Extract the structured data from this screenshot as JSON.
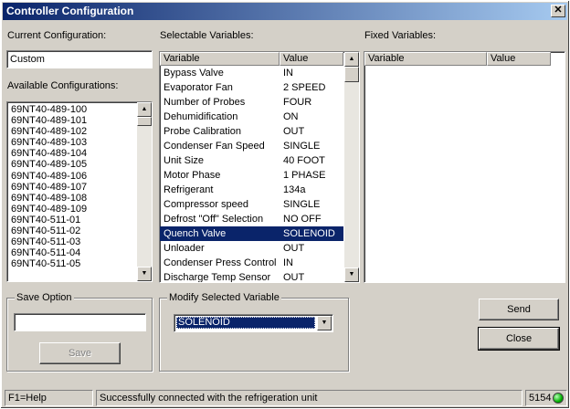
{
  "window": {
    "title": "Controller Configuration",
    "close_glyph": "✕"
  },
  "current_config": {
    "label": "Current Configuration:",
    "value": "Custom"
  },
  "available_configs": {
    "label": "Available Configurations:",
    "items": [
      "69NT40-489-100",
      "69NT40-489-101",
      "69NT40-489-102",
      "69NT40-489-103",
      "69NT40-489-104",
      "69NT40-489-105",
      "69NT40-489-106",
      "69NT40-489-107",
      "69NT40-489-108",
      "69NT40-489-109",
      "69NT40-511-01",
      "69NT40-511-02",
      "69NT40-511-03",
      "69NT40-511-04",
      "69NT40-511-05"
    ]
  },
  "selectable_vars": {
    "label": "Selectable Variables:",
    "col_variable": "Variable",
    "col_value": "Value",
    "selected_index": 12,
    "rows": [
      {
        "variable": "Bypass Valve",
        "value": "IN"
      },
      {
        "variable": "Evaporator Fan",
        "value": "2 SPEED"
      },
      {
        "variable": "Number of Probes",
        "value": "FOUR"
      },
      {
        "variable": "Dehumidification",
        "value": "ON"
      },
      {
        "variable": "Probe Calibration",
        "value": "OUT"
      },
      {
        "variable": "Condenser Fan Speed",
        "value": "SINGLE"
      },
      {
        "variable": "Unit Size",
        "value": "40 FOOT"
      },
      {
        "variable": "Motor Phase",
        "value": "1 PHASE"
      },
      {
        "variable": "Refrigerant",
        "value": "134a"
      },
      {
        "variable": "Compressor speed",
        "value": "SINGLE"
      },
      {
        "variable": "Defrost \"Off\" Selection",
        "value": "NO OFF"
      },
      {
        "variable": "Quench Valve",
        "value": "SOLENOID"
      },
      {
        "variable": "Unloader",
        "value": "OUT"
      },
      {
        "variable": "Condenser Press Control",
        "value": "IN"
      },
      {
        "variable": "Discharge Temp Sensor",
        "value": "OUT"
      }
    ]
  },
  "fixed_vars": {
    "label": "Fixed Variables:",
    "col_variable": "Variable",
    "col_value": "Value"
  },
  "save_option": {
    "title": "Save Option",
    "input_value": "",
    "save_label": "Save"
  },
  "modify_var": {
    "title": "Modify Selected Variable",
    "selected_value": "SOLENOID"
  },
  "buttons": {
    "send": "Send",
    "close": "Close"
  },
  "status": {
    "help": "F1=Help",
    "message": "Successfully connected with the refrigeration unit",
    "code": "5154"
  },
  "icons": {
    "scroll_up": "▲",
    "scroll_down": "▼",
    "combo_arrow": "▼"
  },
  "colors": {
    "selection": "#0a246a",
    "connected_led": "#00b000"
  }
}
